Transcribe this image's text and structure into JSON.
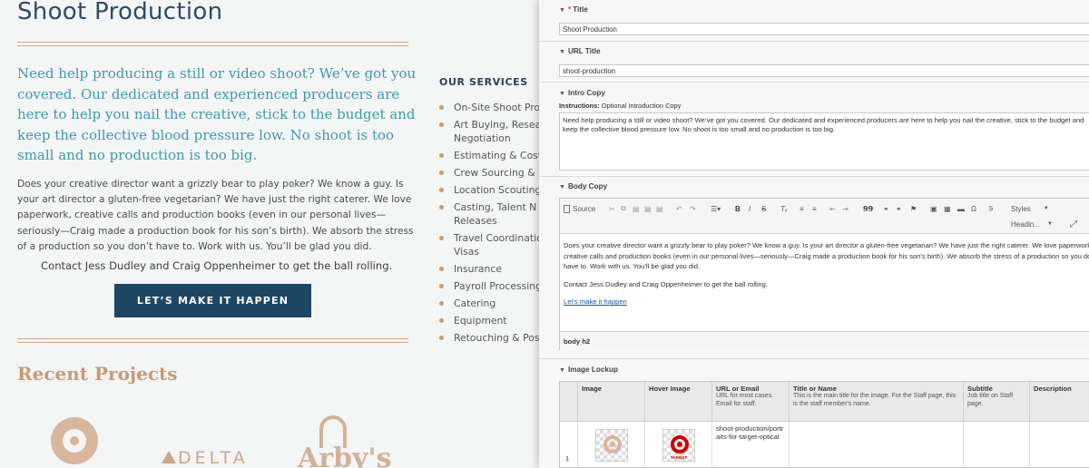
{
  "site": {
    "title": "Shoot Production",
    "lead": "Need help producing a still or video shoot? We’ve got you covered. Our dedicated and experienced producers are here to help you nail the creative, stick to the budget and keep the collective blood pressure low. No shoot is too small and no production is too big.",
    "body": "Does your creative director want a grizzly bear to play poker? We know a guy. Is your art director a gluten-free vegetarian? We have just the right caterer. We love paperwork, creative calls and production books (even in our personal lives—seriously—Craig made a production book for his son’s birth). We absorb the stress of a production so you don’t have to. Work with us. You’ll be glad you did.",
    "contact": "Contact Jess Dudley and Craig Oppenheimer to get the ball rolling.",
    "cta": "LET’S MAKE IT HAPPEN",
    "recent_heading": "Recent Projects",
    "services_heading": "OUR SERVICES",
    "services": [
      "On-Site Shoot Pro",
      "Art Buying, Resea Negotiation",
      "Estimating & Cost",
      "Crew Sourcing & I",
      "Location Scouting",
      "Casting, Talent N Releases",
      "Travel Coordinatio Visas",
      "Insurance",
      "Payroll Processing",
      "Catering",
      "Equipment",
      "Retouching & Pos"
    ],
    "logos": {
      "delta": "DELTA",
      "arbys": "Arby's"
    },
    "colors": {
      "title": "#2f4a66",
      "lead": "#3d9aa6",
      "accent": "#c89b73",
      "button": "#1f4763"
    }
  },
  "cms": {
    "title_field": {
      "label": "Title",
      "required_mark": "*",
      "value": "Shoot Production"
    },
    "url_field": {
      "label": "URL Title",
      "value": "shoot-production"
    },
    "intro_field": {
      "label": "Intro Copy",
      "instructions_label": "Instructions:",
      "instructions": "Optional Introduction Copy",
      "value": "Need help producing a still or video shoot? We’ve got you covered. Our dedicated and experienced producers are here to help you nail the creative, stick to the budget and keep the collective blood pressure low. No shoot is too small and no production is too big."
    },
    "body_field": {
      "label": "Body Copy",
      "toolbar": {
        "source": "Source",
        "bold": "B",
        "italic": "I",
        "strike": "S",
        "quote": "99",
        "styles": "Styles",
        "format": "Headin..."
      },
      "paragraphs": [
        "Does your creative director want a grizzly bear to play poker? We know a guy. Is your art director a gluten-free vegetarian? We have just the right caterer. We love paperwork, creative calls and production books (even in our personal lives—seriously—Craig made a production book for his son’s birth). We absorb the stress of a production so you don’t have to. Work with us. You’ll be glad you did.",
        "Contact Jess Dudley and Craig Oppenheimer to get the ball rolling."
      ],
      "link": "Let's make it happen",
      "path": "body  h2"
    },
    "lockup_field": {
      "label": "Image Lockup",
      "columns": [
        {
          "name": "Image",
          "desc": ""
        },
        {
          "name": "Hover Image",
          "desc": ""
        },
        {
          "name": "URL or Email",
          "desc": "URL for most cases. Email for staff."
        },
        {
          "name": "Title or Name",
          "desc": "This is the main title for the image. For the Staff page, this is the staff member's name."
        },
        {
          "name": "Subtitle",
          "desc": "Job title on Staff page."
        },
        {
          "name": "Description",
          "desc": ""
        }
      ],
      "row_number": "1",
      "row_url": "shoot-production/portraits-for-target-optical",
      "hover_caption": "TARGET"
    }
  }
}
